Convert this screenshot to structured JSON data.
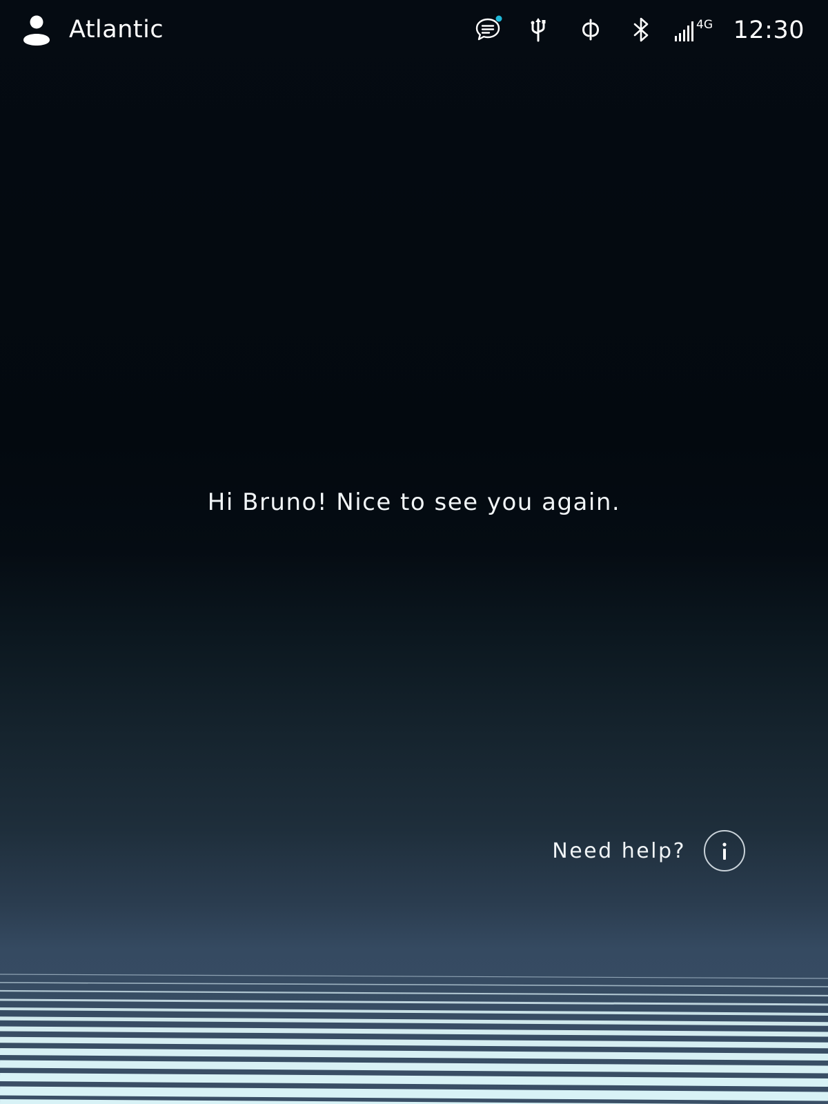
{
  "header": {
    "user_name": "Atlantic",
    "clock": "12:30",
    "icons": {
      "user": "user-profile-icon",
      "messages": "chat-bubble-icon",
      "usb": "usb-icon",
      "wireless_charging": "wireless-charging-icon",
      "bluetooth": "bluetooth-icon",
      "signal": "cellular-signal-icon"
    },
    "network_type": "4G",
    "notification_dot_color": "#1fb8d8"
  },
  "main": {
    "greeting": "Hi Bruno! Nice to see you again."
  },
  "help": {
    "label": "Need help?",
    "button_icon": "info-icon"
  },
  "colors": {
    "background_top": "#03090f",
    "background_bottom": "#3a4f66",
    "wave_light": "#d8f2f6",
    "wave_dark": "#46596d"
  }
}
